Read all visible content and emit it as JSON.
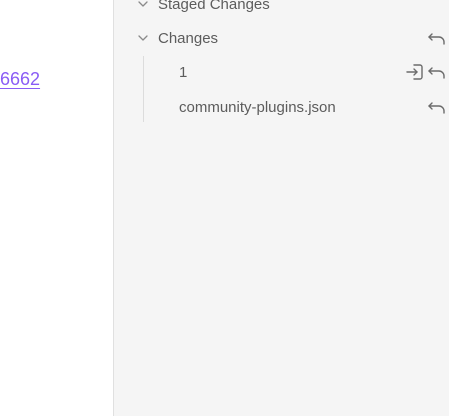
{
  "editor": {
    "link_text": "6662"
  },
  "source_control": {
    "staged_section": {
      "label": "Staged Changes"
    },
    "changes_section": {
      "label": "Changes",
      "files": [
        {
          "name": "1"
        },
        {
          "name": "community-plugins.json"
        }
      ]
    }
  },
  "icons": {
    "collapse": "chevron-down-icon",
    "discard": "undo-arrow-icon",
    "stage": "stage-file-icon"
  },
  "colors": {
    "link": "#8a5cf5",
    "pane_bg": "#f5f5f5",
    "text": "#5c5c5c",
    "icon": "#6b6b6b"
  }
}
